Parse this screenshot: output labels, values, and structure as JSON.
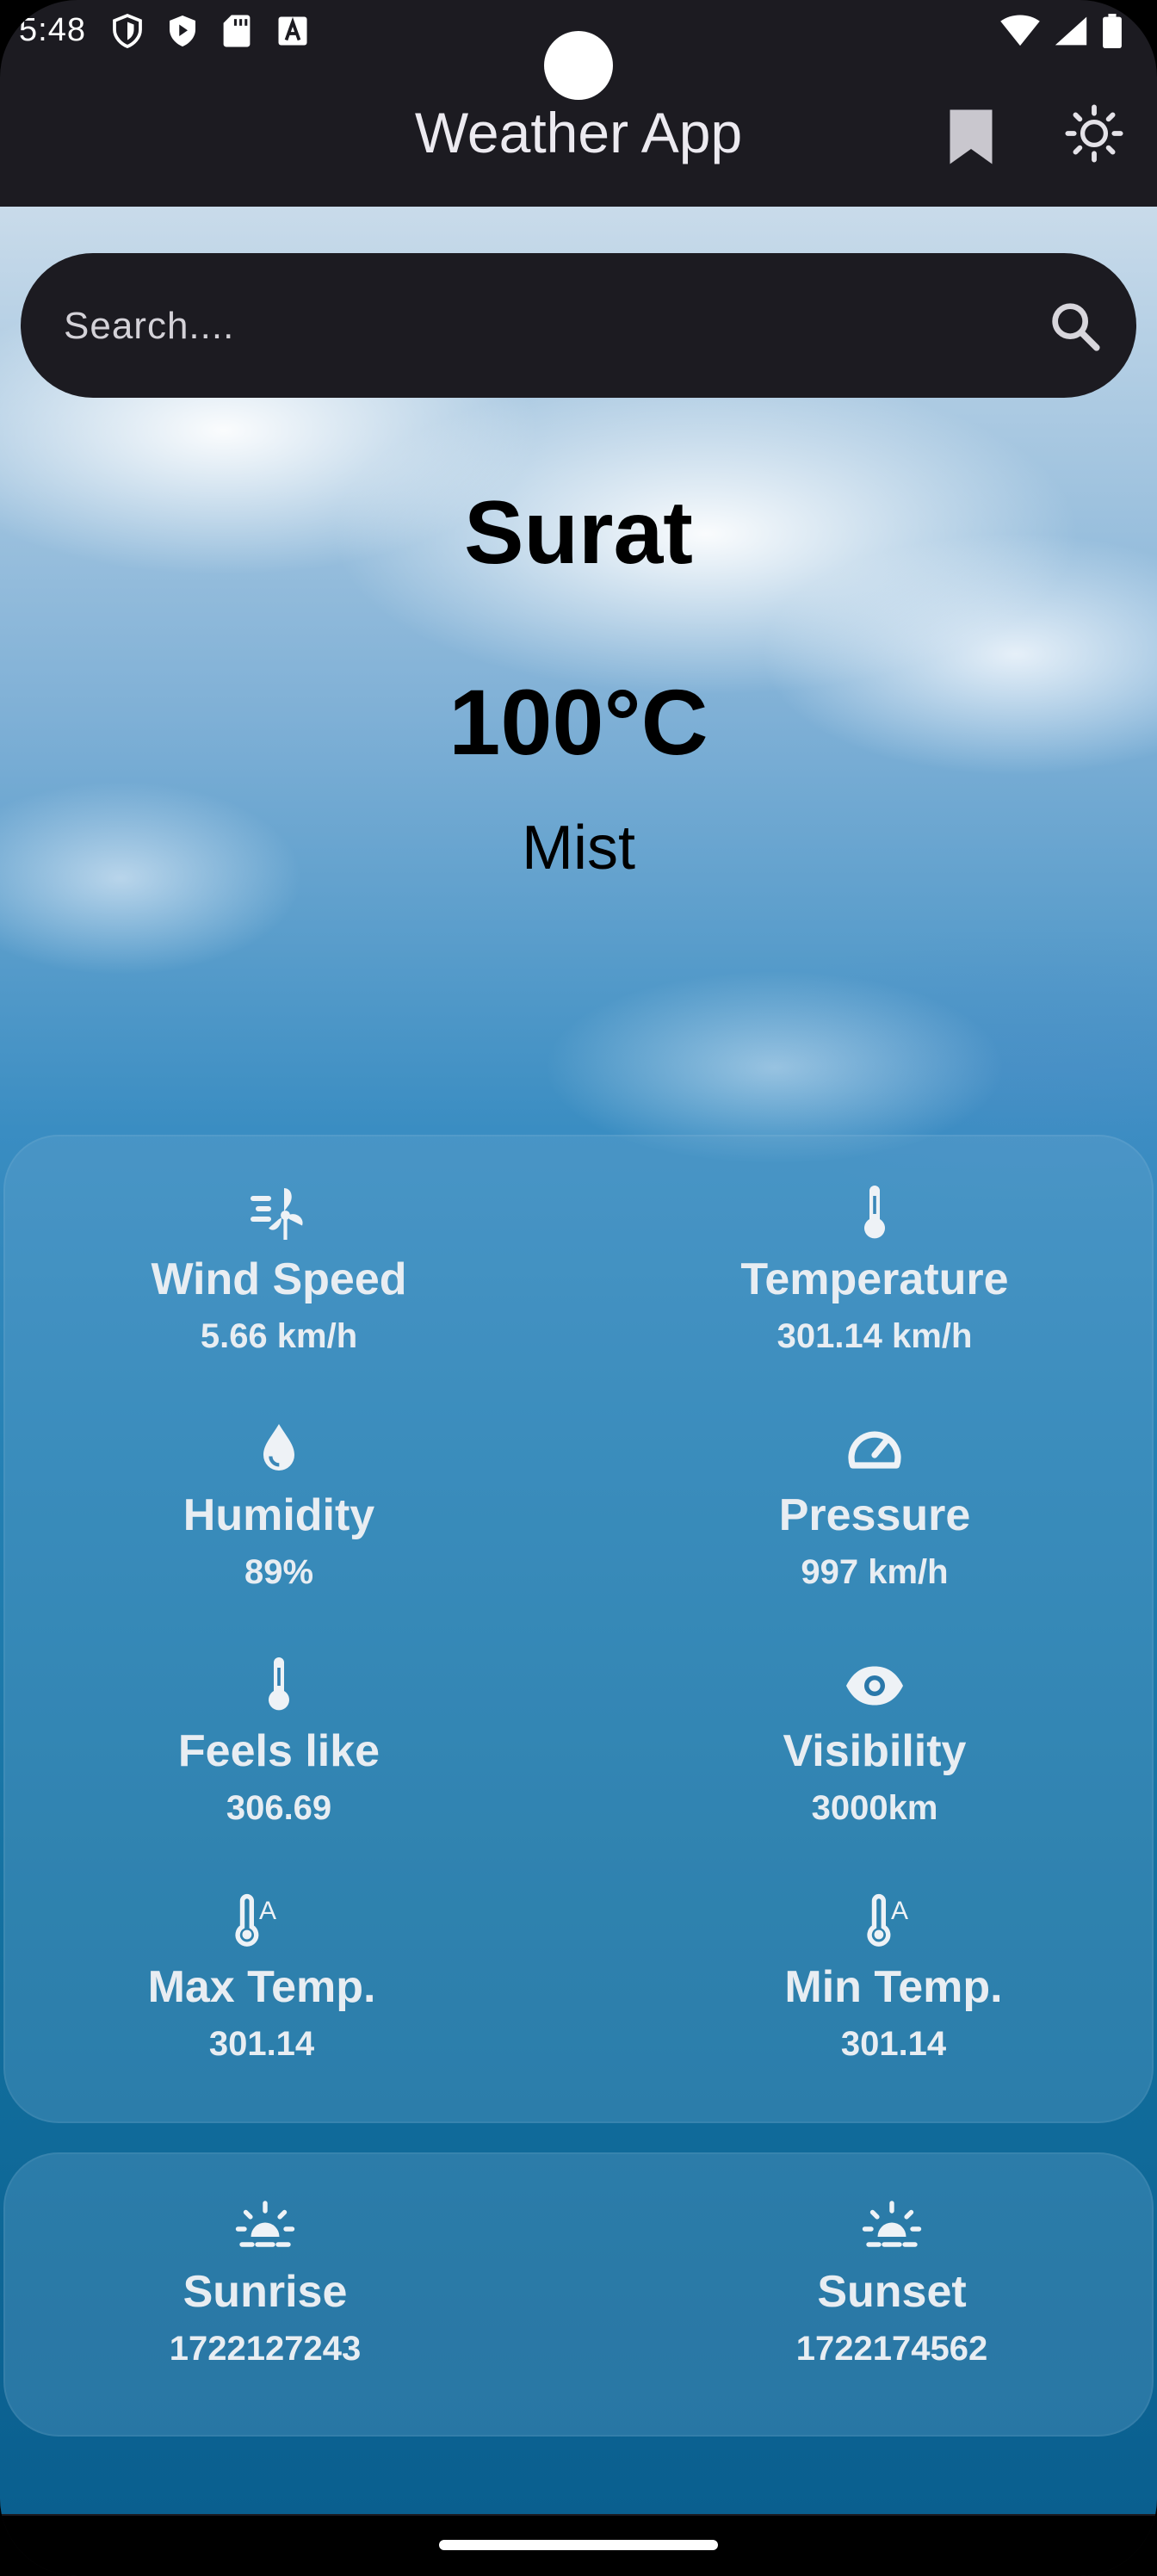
{
  "status_bar": {
    "time": "5:48"
  },
  "app_bar": {
    "title": "Weather App"
  },
  "search": {
    "placeholder": "Search...."
  },
  "weather": {
    "city": "Surat",
    "temperature": "100°C",
    "condition": "Mist"
  },
  "details": [
    {
      "label": "Wind Speed",
      "value": "5.66 km/h",
      "icon": "wind-turbine-icon"
    },
    {
      "label": "Temperature",
      "value": "301.14 km/h",
      "icon": "thermometer-icon"
    },
    {
      "label": "Humidity",
      "value": "89%",
      "icon": "water-drop-icon"
    },
    {
      "label": "Pressure",
      "value": "997 km/h",
      "icon": "speedometer-icon"
    },
    {
      "label": "Feels like",
      "value": "306.69",
      "icon": "thermometer-icon"
    },
    {
      "label": "Visibility",
      "value": "3000km",
      "icon": "eye-icon"
    },
    {
      "label": "Max Temp.",
      "value": "301.14",
      "icon": "thermostat-auto-icon"
    },
    {
      "label": "Min Temp.",
      "value": "301.14",
      "icon": "thermostat-auto-icon"
    }
  ],
  "sun": {
    "sunrise_label": "Sunrise",
    "sunrise_value": "1722127243",
    "sunset_label": "Sunset",
    "sunset_value": "1722174562"
  },
  "colors": {
    "app_bar": "#1c1b21",
    "text_light": "#e8edf2",
    "sky_top": "#c9dbea",
    "sky_bottom": "#0a5f8f"
  }
}
